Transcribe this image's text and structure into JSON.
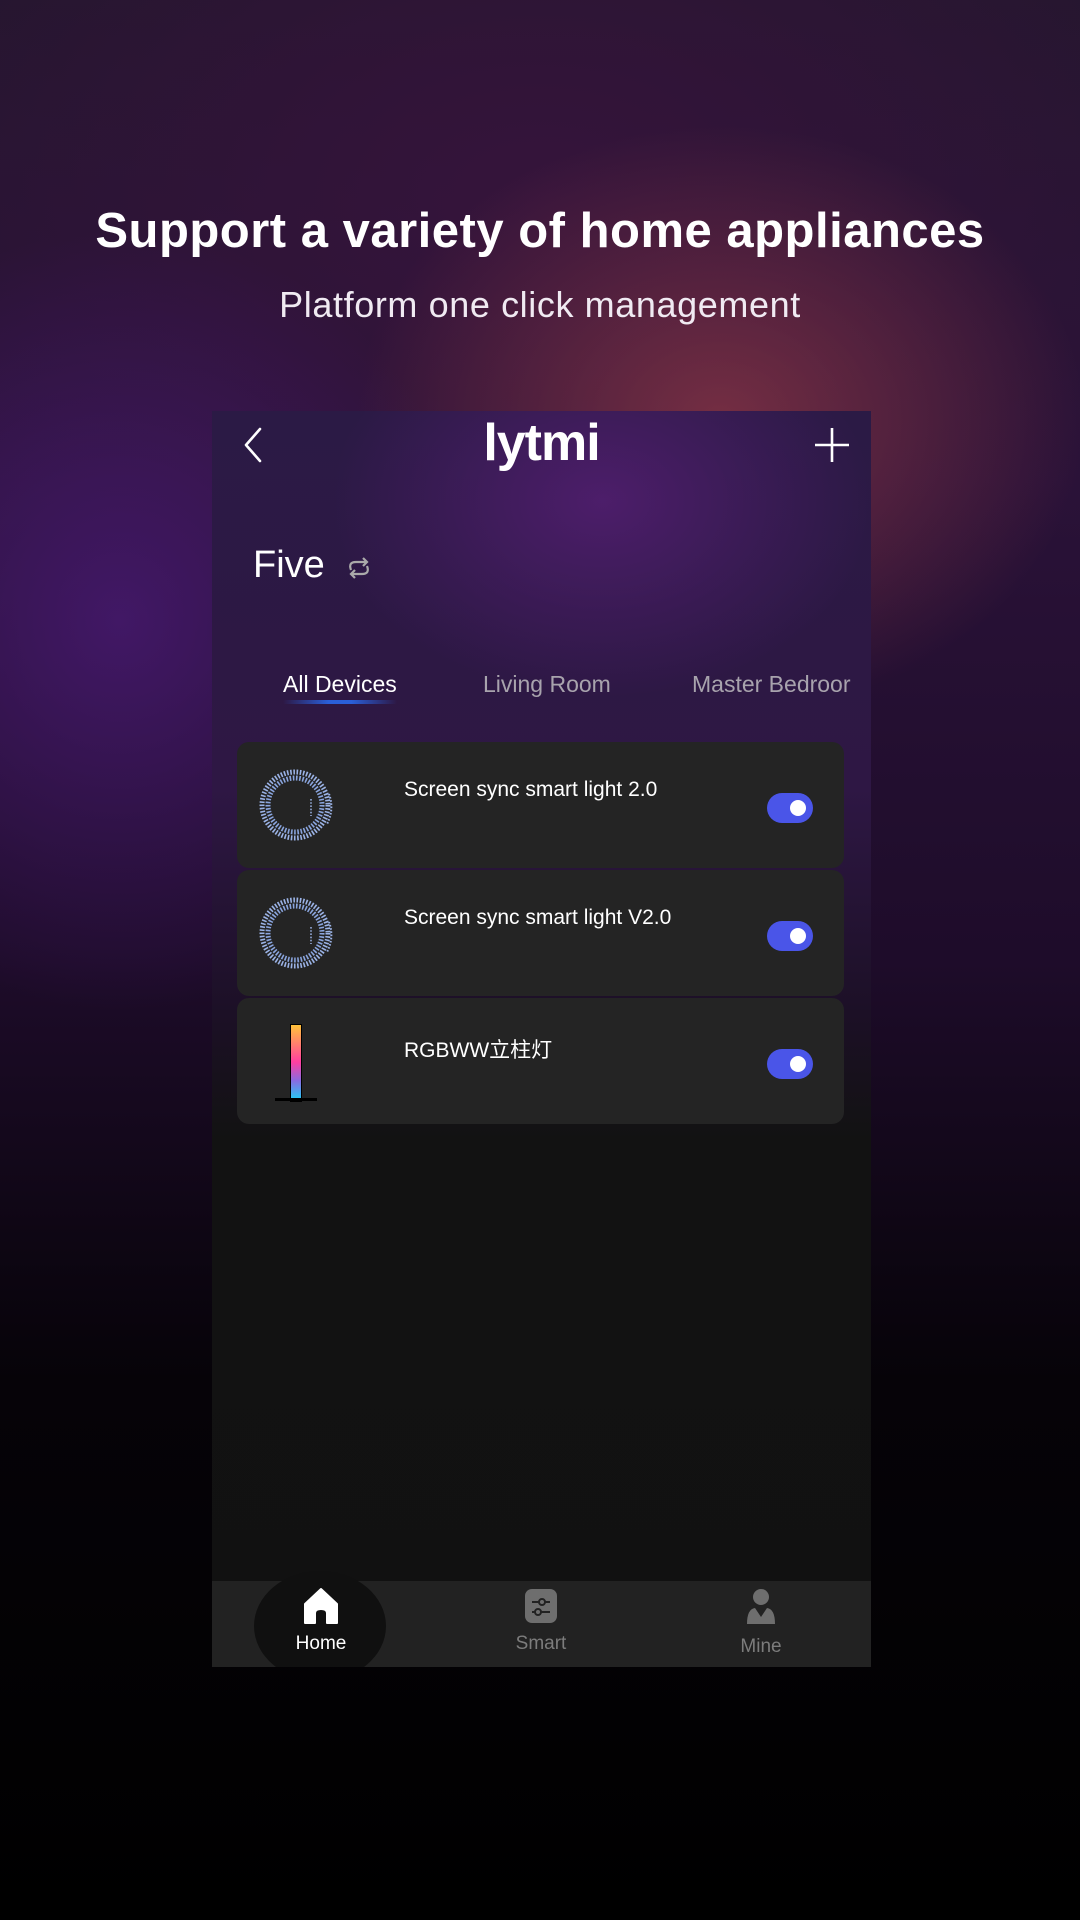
{
  "hero": {
    "title": "Support a variety of home appliances",
    "subtitle": "Platform one click management"
  },
  "app": {
    "logo": "lytmi",
    "back_icon": "chevron-left-icon",
    "add_icon": "plus-icon",
    "home_name": "Five",
    "switch_icon": "swap-arrows-icon",
    "tabs": [
      {
        "label": "All Devices",
        "active": true
      },
      {
        "label": "Living Room",
        "active": false
      },
      {
        "label": "Master Bedroor",
        "active": false
      }
    ],
    "devices": [
      {
        "name": "Screen sync smart light 2.0",
        "icon": "led-strip-coil-icon",
        "on": true
      },
      {
        "name": "Screen sync smart light V2.0",
        "icon": "led-strip-coil-icon",
        "on": true
      },
      {
        "name": "RGBWW立柱灯",
        "icon": "light-bar-icon",
        "on": true
      }
    ],
    "toggle_color": "#4a55e8",
    "nav": [
      {
        "label": "Home",
        "icon": "home-icon",
        "active": true
      },
      {
        "label": "Smart",
        "icon": "sliders-icon",
        "active": false
      },
      {
        "label": "Mine",
        "icon": "user-icon",
        "active": false
      }
    ]
  }
}
